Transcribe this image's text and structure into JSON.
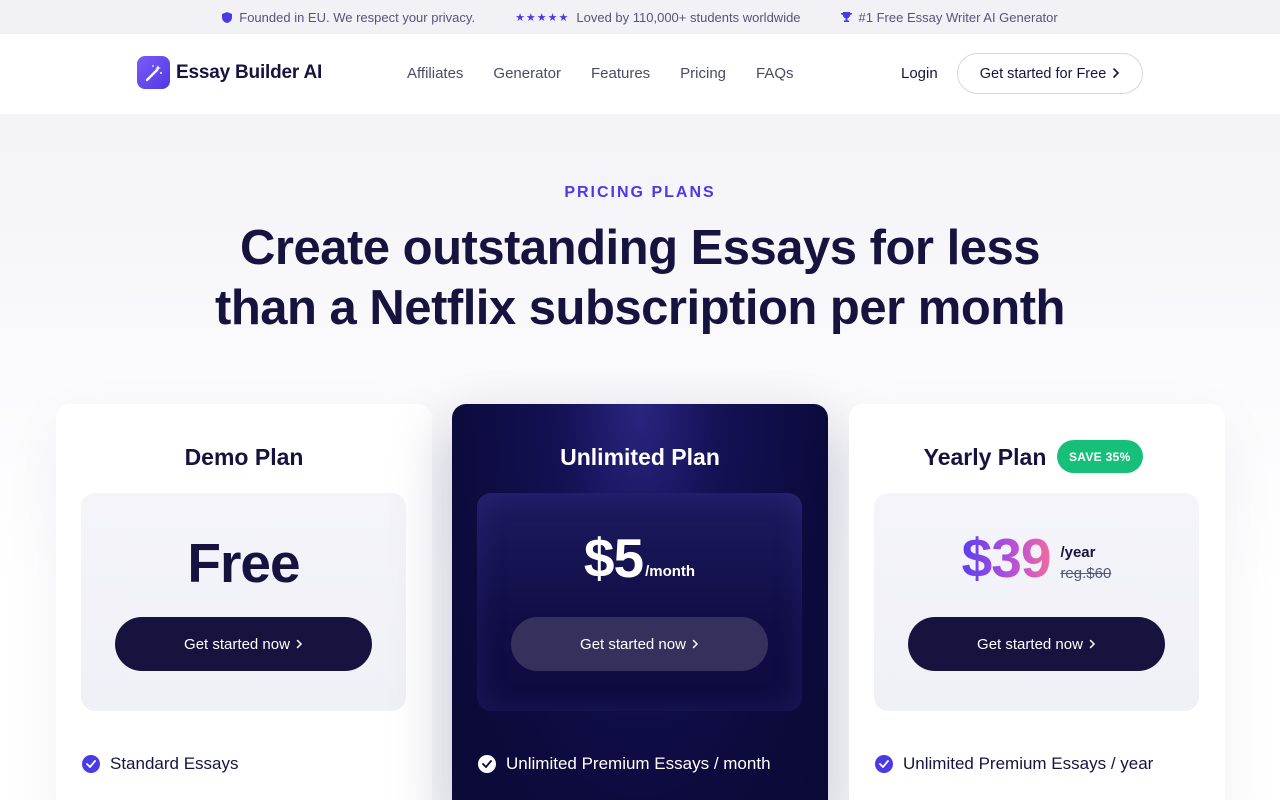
{
  "topbar": {
    "items": [
      {
        "icon": "shield-icon",
        "text": "Founded in EU. We respect your privacy."
      },
      {
        "icon": "stars-icon",
        "stars": "★★★★★",
        "text": "Loved by 110,000+ students worldwide"
      },
      {
        "icon": "trophy-icon",
        "text": "#1 Free Essay Writer AI Generator"
      }
    ]
  },
  "header": {
    "logo_text": "Essay Builder AI",
    "logo_icon": "magic-wand-icon",
    "nav": [
      "Affiliates",
      "Generator",
      "Features",
      "Pricing",
      "FAQs"
    ],
    "login": "Login",
    "cta": "Get started for Free",
    "cta_icon": "chevron-right-icon"
  },
  "hero": {
    "eyebrow": "PRICING PLANS",
    "headline_line1": "Create outstanding Essays for less",
    "headline_line2": "than a Netflix subscription per month"
  },
  "plans": [
    {
      "title": "Demo Plan",
      "price": "Free",
      "button": "Get started now",
      "feature": "Standard Essays"
    },
    {
      "title": "Unlimited Plan",
      "price": "$5",
      "unit": "/month",
      "button": "Get started now",
      "feature": "Unlimited Premium Essays / month"
    },
    {
      "title": "Yearly Plan",
      "badge": "SAVE 35%",
      "price": "$39",
      "unit": "/year",
      "regular": "reg.$60",
      "button": "Get started now",
      "feature": "Unlimited Premium Essays / year"
    }
  ],
  "colors": {
    "accent": "#4a3ae6",
    "navy": "#16133f",
    "badge_green": "#17c07a"
  }
}
